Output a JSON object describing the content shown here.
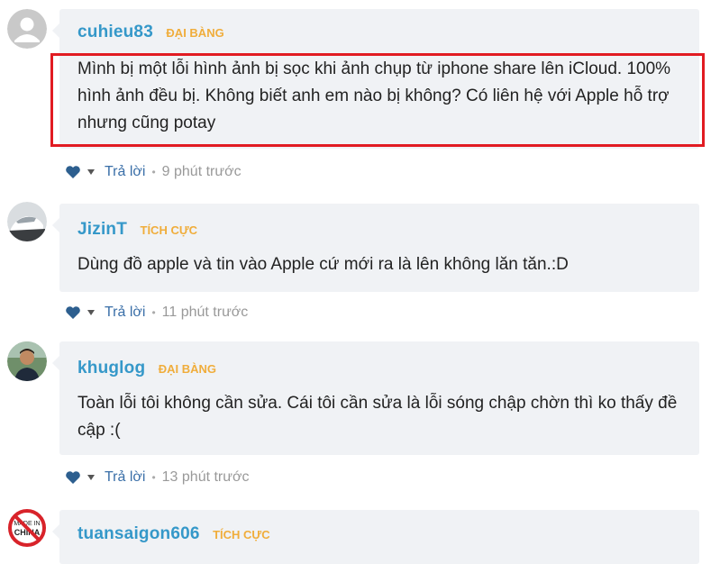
{
  "comments": [
    {
      "username": "cuhieu83",
      "rank": "ĐẠI BÀNG",
      "content": "Mình bị một lỗi hình ảnh bị sọc khi ảnh chụp từ iphone share lên iCloud. 100% hình ảnh đều bị. Không biết anh em nào bị không? Có liên hệ với Apple hỗ trợ nhưng cũng potay",
      "reply_label": "Trả lời",
      "time": "9 phút trước",
      "avatar": "default-avatar"
    },
    {
      "username": "JizinT",
      "rank": "TÍCH CỰC",
      "content": "Dùng đồ apple và tin vào Apple cứ mới ra là lên không lăn tăn.:D",
      "reply_label": "Trả lời",
      "time": "11 phút trước",
      "avatar": "car-avatar"
    },
    {
      "username": "khuglog",
      "rank": "ĐẠI BÀNG",
      "content": "Toàn lỗi tôi không cần sửa. Cái tôi cần sửa là lỗi sóng chập chờn thì ko thấy đề cập :(",
      "reply_label": "Trả lời",
      "time": "13 phút trước",
      "avatar": "person-avatar"
    },
    {
      "username": "tuansaigon606",
      "rank": "TÍCH CỰC",
      "avatar": "no-made-in-china-avatar",
      "avatar_text": "MADE IN CHINA"
    }
  ],
  "colors": {
    "username": "#3598c9",
    "rank": "#f0ad3b",
    "highlight": "#e11b22",
    "bubble": "#f0f2f5",
    "heart": "#2d5f8f"
  }
}
